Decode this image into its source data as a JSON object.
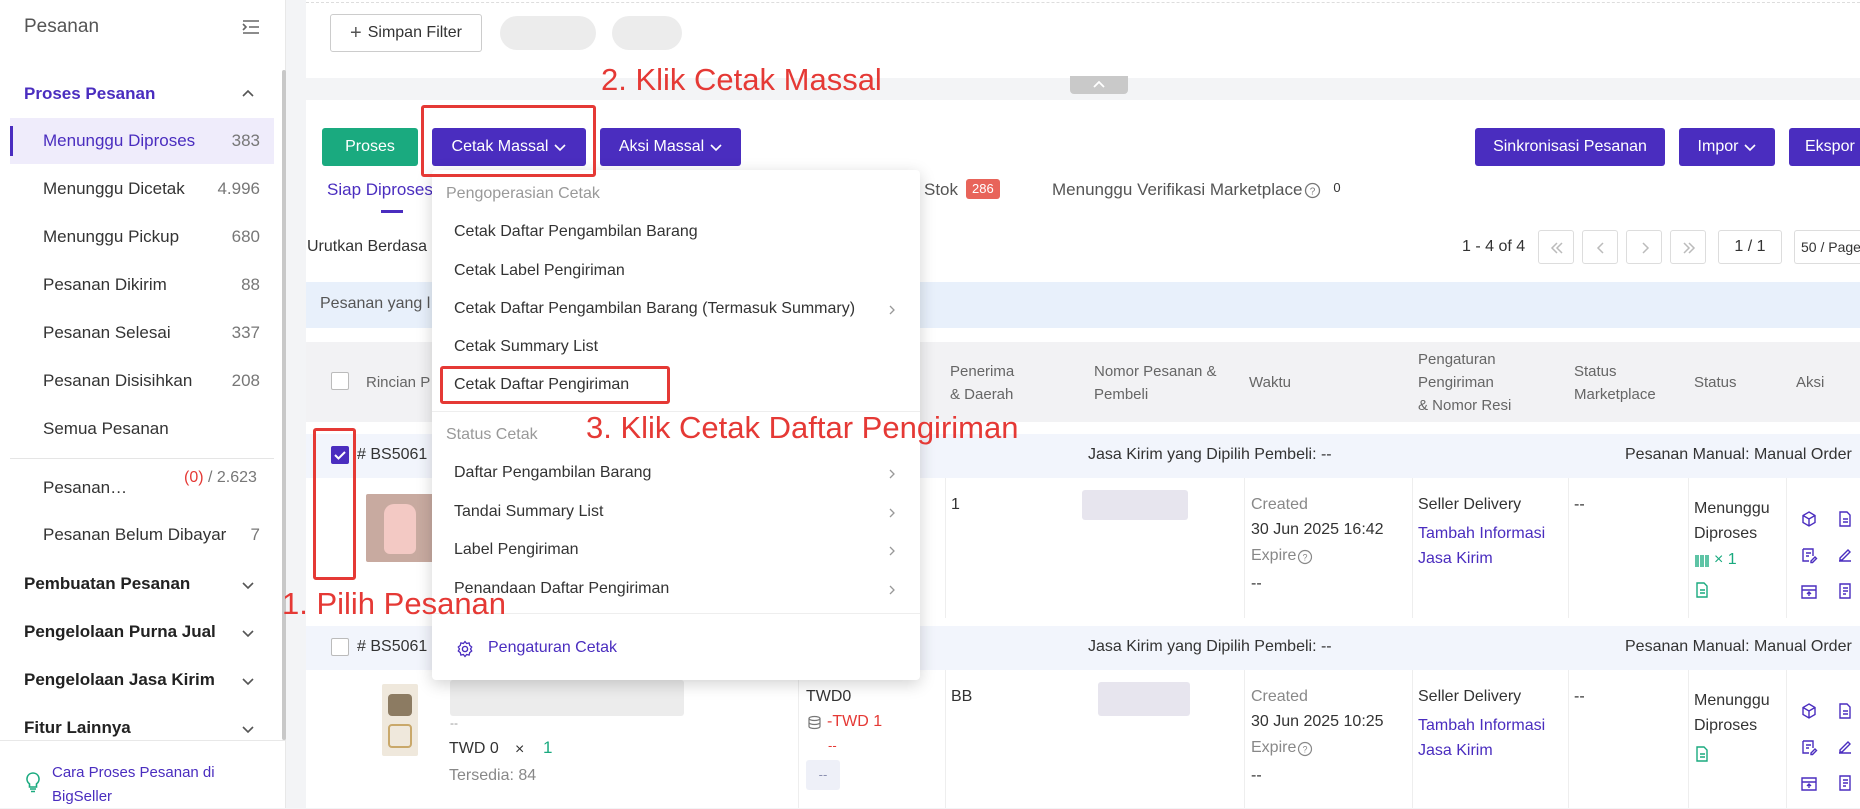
{
  "sidebar": {
    "title": "Pesanan",
    "active_group": "Proses Pesanan",
    "items": [
      {
        "label": "Menunggu Diproses",
        "count": "383"
      },
      {
        "label": "Menunggu Dicetak",
        "count": "4.996"
      },
      {
        "label": "Menunggu Pickup",
        "count": "680"
      },
      {
        "label": "Pesanan Dikirim",
        "count": "88"
      },
      {
        "label": "Pesanan Selesai",
        "count": "337"
      },
      {
        "label": "Pesanan Disisihkan",
        "count": "208"
      },
      {
        "label": "Semua Pesanan",
        "count": ""
      }
    ],
    "extra_items": [
      {
        "label": "Pesanan…",
        "count_red": "(0)",
        "count_rest": " / 2.623"
      },
      {
        "label": "Pesanan Belum Dibayar",
        "count": "7"
      }
    ],
    "groups": [
      "Pembuatan Pesanan",
      "Pengelolaan Purna Jual",
      "Pengelolaan Jasa Kirim",
      "Fitur Lainnya"
    ],
    "footer_link": "Cara Proses Pesanan di BigSeller"
  },
  "toolbar": {
    "save_filter": "Simpan Filter",
    "proses": "Proses",
    "cetak_massal": "Cetak Massal",
    "aksi_massal": "Aksi Massal",
    "sinkronisasi": "Sinkronisasi Pesanan",
    "impor": "Impor",
    "ekspor": "Ekspor"
  },
  "tabs": {
    "siap": "Siap Diproses",
    "stok": "Stok",
    "stok_badge": "286",
    "verifikasi": "Menunggu Verifikasi Marketplace",
    "verifikasi_count": "0"
  },
  "sort_label": "Urutkan Berdasa",
  "notice": "Pesanan yang l",
  "pagination": {
    "range": "1 - 4 of 4",
    "page": "1 / 1",
    "per_page": "50 / Page"
  },
  "table_headers": {
    "rincian": "Rincian P",
    "penerima": "Penerima\n& Daerah",
    "nomor": "Nomor Pesanan &\nPembeli",
    "waktu": "Waktu",
    "pengaturan": "Pengaturan\nPengiriman\n& Nomor Resi",
    "status_mp": "Status\nMarketplace",
    "status": "Status",
    "aksi": "Aksi"
  },
  "orders": [
    {
      "id": "# BS5061",
      "jasa_kirim": "Jasa Kirim yang Dipilih Pembeli: --",
      "manual": "Pesanan Manual: Manual Order",
      "penerima": "1",
      "created": "Created",
      "date": "30 Jun 2025 16:42",
      "expire": "Expire",
      "expire_val": "--",
      "delivery": "Seller Delivery",
      "tambah": "Tambah Informasi Jasa Kirim",
      "status_mp": "--",
      "status": "Menunggu Diproses",
      "qty": "× 1"
    },
    {
      "id": "# BS5061",
      "jasa_kirim": "Jasa Kirim yang Dipilih Pembeli: --",
      "manual": "Pesanan Manual: Manual Order",
      "penerima": "BB",
      "created": "Created",
      "date": "30 Jun 2025 10:25",
      "expire": "Expire",
      "expire_val": "--",
      "delivery": "Seller Delivery",
      "tambah": "Tambah Informasi Jasa Kirim",
      "status_mp": "--",
      "status": "Menunggu Diproses",
      "price": "TWD 0",
      "qty": "× 1",
      "stock": "Tersedia: 84",
      "twd0": "TWD0",
      "twd_red": "-TWD 1",
      "dash_red": "--",
      "dash_box": "--",
      "dash_small": "--"
    }
  ],
  "dropdown": {
    "section1": "Pengoperasian Cetak",
    "items1": [
      "Cetak Daftar Pengambilan Barang",
      "Cetak Label Pengiriman",
      "Cetak Daftar Pengambilan Barang (Termasuk Summary)",
      "Cetak Summary List",
      "Cetak Daftar Pengiriman"
    ],
    "section2": "Status Cetak",
    "items2": [
      "Daftar Pengambilan Barang",
      "Tandai Summary List",
      "Label Pengiriman",
      "Penandaan Daftar Pengiriman"
    ],
    "settings": "Pengaturan Cetak"
  },
  "annotations": {
    "step1": "1. Pilih Pesanan",
    "step2": "2. Klik Cetak Massal",
    "step3": "3. Klik Cetak Daftar Pengiriman"
  },
  "colors": {
    "accent": "#4a2dbf",
    "green": "#1aaa7f",
    "annotation": "#e53935"
  }
}
